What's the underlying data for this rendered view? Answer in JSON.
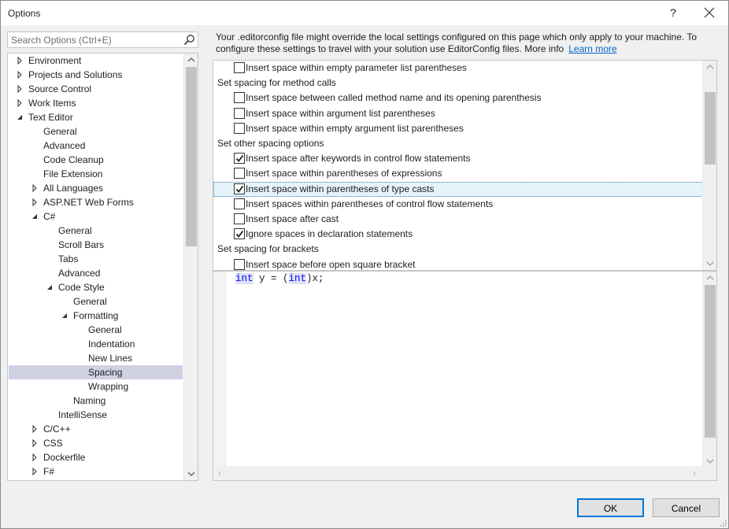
{
  "window": {
    "title": "Options",
    "help_glyph": "?"
  },
  "search": {
    "placeholder": "Search Options (Ctrl+E)"
  },
  "tree": {
    "items": [
      {
        "label": "Environment",
        "level": 0,
        "state": "collapsed"
      },
      {
        "label": "Projects and Solutions",
        "level": 0,
        "state": "collapsed"
      },
      {
        "label": "Source Control",
        "level": 0,
        "state": "collapsed"
      },
      {
        "label": "Work Items",
        "level": 0,
        "state": "collapsed"
      },
      {
        "label": "Text Editor",
        "level": 0,
        "state": "expanded"
      },
      {
        "label": "General",
        "level": 1,
        "state": "leaf"
      },
      {
        "label": "Advanced",
        "level": 1,
        "state": "leaf"
      },
      {
        "label": "Code Cleanup",
        "level": 1,
        "state": "leaf"
      },
      {
        "label": "File Extension",
        "level": 1,
        "state": "leaf"
      },
      {
        "label": "All Languages",
        "level": 1,
        "state": "collapsed"
      },
      {
        "label": "ASP.NET Web Forms",
        "level": 1,
        "state": "collapsed"
      },
      {
        "label": "C#",
        "level": 1,
        "state": "expanded"
      },
      {
        "label": "General",
        "level": 2,
        "state": "leaf"
      },
      {
        "label": "Scroll Bars",
        "level": 2,
        "state": "leaf"
      },
      {
        "label": "Tabs",
        "level": 2,
        "state": "leaf"
      },
      {
        "label": "Advanced",
        "level": 2,
        "state": "leaf"
      },
      {
        "label": "Code Style",
        "level": 2,
        "state": "expanded"
      },
      {
        "label": "General",
        "level": 3,
        "state": "leaf"
      },
      {
        "label": "Formatting",
        "level": 3,
        "state": "expanded"
      },
      {
        "label": "General",
        "level": 4,
        "state": "leaf"
      },
      {
        "label": "Indentation",
        "level": 4,
        "state": "leaf"
      },
      {
        "label": "New Lines",
        "level": 4,
        "state": "leaf"
      },
      {
        "label": "Spacing",
        "level": 4,
        "state": "leaf",
        "selected": true
      },
      {
        "label": "Wrapping",
        "level": 4,
        "state": "leaf"
      },
      {
        "label": "Naming",
        "level": 3,
        "state": "leaf"
      },
      {
        "label": "IntelliSense",
        "level": 2,
        "state": "leaf"
      },
      {
        "label": "C/C++",
        "level": 1,
        "state": "collapsed"
      },
      {
        "label": "CSS",
        "level": 1,
        "state": "collapsed"
      },
      {
        "label": "Dockerfile",
        "level": 1,
        "state": "collapsed"
      },
      {
        "label": "F#",
        "level": 1,
        "state": "collapsed"
      }
    ],
    "scroll_fraction": 0.0
  },
  "info": {
    "text": "Your .editorconfig file might override the local settings configured on this page which only apply to your machine. To configure these settings to travel with your solution use EditorConfig files. More info",
    "link": "Learn more"
  },
  "options": {
    "rows": [
      {
        "type": "checkbox",
        "label": "Insert space within empty parameter list parentheses",
        "checked": false
      },
      {
        "type": "header",
        "label": "Set spacing for method calls"
      },
      {
        "type": "checkbox",
        "label": "Insert space between called method name and its opening parenthesis",
        "checked": false
      },
      {
        "type": "checkbox",
        "label": "Insert space within argument list parentheses",
        "checked": false
      },
      {
        "type": "checkbox",
        "label": "Insert space within empty argument list parentheses",
        "checked": false
      },
      {
        "type": "header",
        "label": "Set other spacing options"
      },
      {
        "type": "checkbox",
        "label": "Insert space after keywords in control flow statements",
        "checked": true
      },
      {
        "type": "checkbox",
        "label": "Insert space within parentheses of expressions",
        "checked": false
      },
      {
        "type": "checkbox",
        "label": "Insert space within parentheses of type casts",
        "checked": true,
        "focused": true
      },
      {
        "type": "checkbox",
        "label": "Insert spaces within parentheses of control flow statements",
        "checked": false
      },
      {
        "type": "checkbox",
        "label": "Insert space after cast",
        "checked": false
      },
      {
        "type": "checkbox",
        "label": "Ignore spaces in declaration statements",
        "checked": true
      },
      {
        "type": "header",
        "label": "Set spacing for brackets"
      },
      {
        "type": "checkbox",
        "label": "Insert space before open square bracket",
        "checked": false
      }
    ]
  },
  "preview": {
    "tokens": [
      {
        "text": "int",
        "kind": "keyword"
      },
      {
        "text": " y = (",
        "kind": "plain"
      },
      {
        "text": "int",
        "kind": "keyword"
      },
      {
        "text": ")x;",
        "kind": "plain"
      }
    ]
  },
  "buttons": {
    "ok": "OK",
    "cancel": "Cancel"
  },
  "colors": {
    "accent": "#0078d7",
    "selection": "#cfd2e3",
    "keyword": "#0000ff",
    "link": "#0066cc"
  }
}
